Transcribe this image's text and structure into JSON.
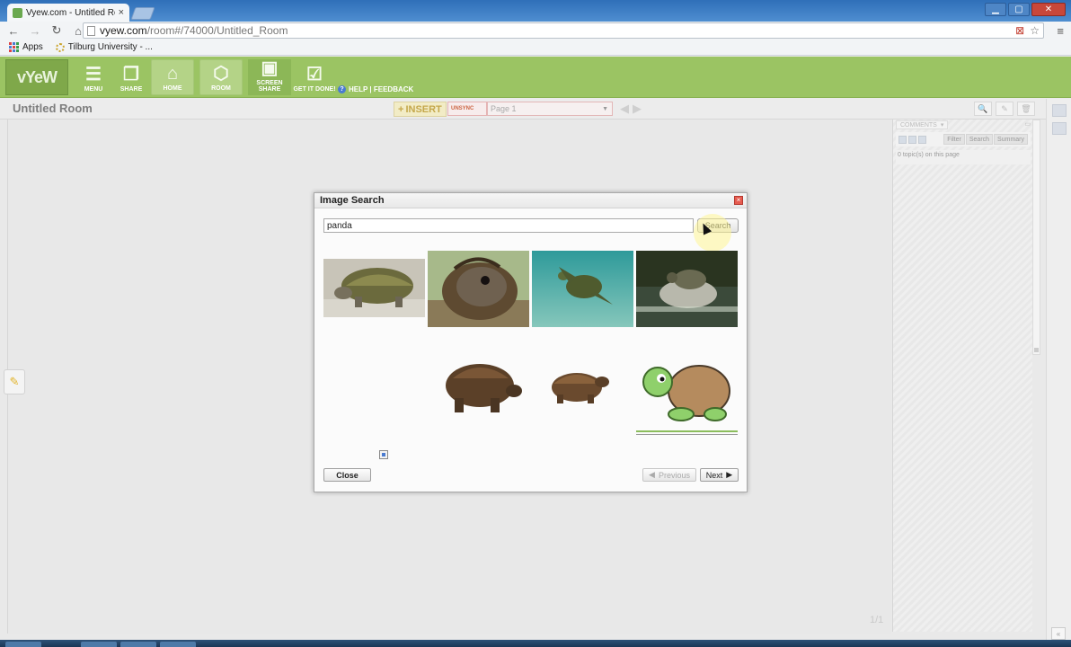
{
  "browser": {
    "tab_title": "Vyew.com - Untitled Room",
    "tab_close": "×",
    "url_domain": "vyew.com",
    "url_path": "/room#/74000/Untitled_Room",
    "bookmarks": [
      {
        "label": "Apps",
        "icon": "apps-grid-icon"
      },
      {
        "label": "Tilburg University - ...",
        "icon": "university-icon"
      }
    ]
  },
  "toolbar": {
    "logo_text": "vYeW",
    "buttons": [
      {
        "label": "MENU",
        "icon": "menu-icon",
        "active": false
      },
      {
        "label": "SHARE",
        "icon": "share-icon",
        "active": false
      },
      {
        "label": "HOME",
        "icon": "home-icon",
        "active": true
      },
      {
        "label": "ROOM",
        "icon": "room-icon",
        "active": true
      },
      {
        "label": "SCREEN SHARE",
        "icon": "screen-share-icon",
        "active": false
      },
      {
        "label": "GET IT DONE!",
        "icon": "checklist-icon",
        "active": false
      }
    ],
    "help_label": "HELP | FEEDBACK",
    "accent": "#9bc463"
  },
  "room": {
    "title": "Untitled Room",
    "insert_label": "INSERT",
    "unsync_label": "UNSYNC",
    "page_select_value": "Page 1",
    "page_count": "1/1"
  },
  "comments": {
    "header_label": "COMMENTS",
    "tabs": [
      "Filter",
      "Search",
      "Summary"
    ],
    "status": "0 topic(s) on this page"
  },
  "dialog": {
    "title": "Image Search",
    "search_value": "panda",
    "search_button": "Search",
    "close_button": "Close",
    "previous_button": "Previous",
    "next_button": "Next",
    "results": [
      {
        "subject": "tortoise on gravel",
        "loaded": true
      },
      {
        "subject": "tortoise head close-up",
        "loaded": true
      },
      {
        "subject": "sea turtle underwater",
        "loaded": true
      },
      {
        "subject": "turtle on rock in water",
        "loaded": true
      },
      {
        "subject": "broken image",
        "loaded": false
      },
      {
        "subject": "brown tortoise",
        "loaded": true
      },
      {
        "subject": "small tortoise",
        "loaded": true
      },
      {
        "subject": "cartoon turtle",
        "loaded": true
      }
    ]
  }
}
